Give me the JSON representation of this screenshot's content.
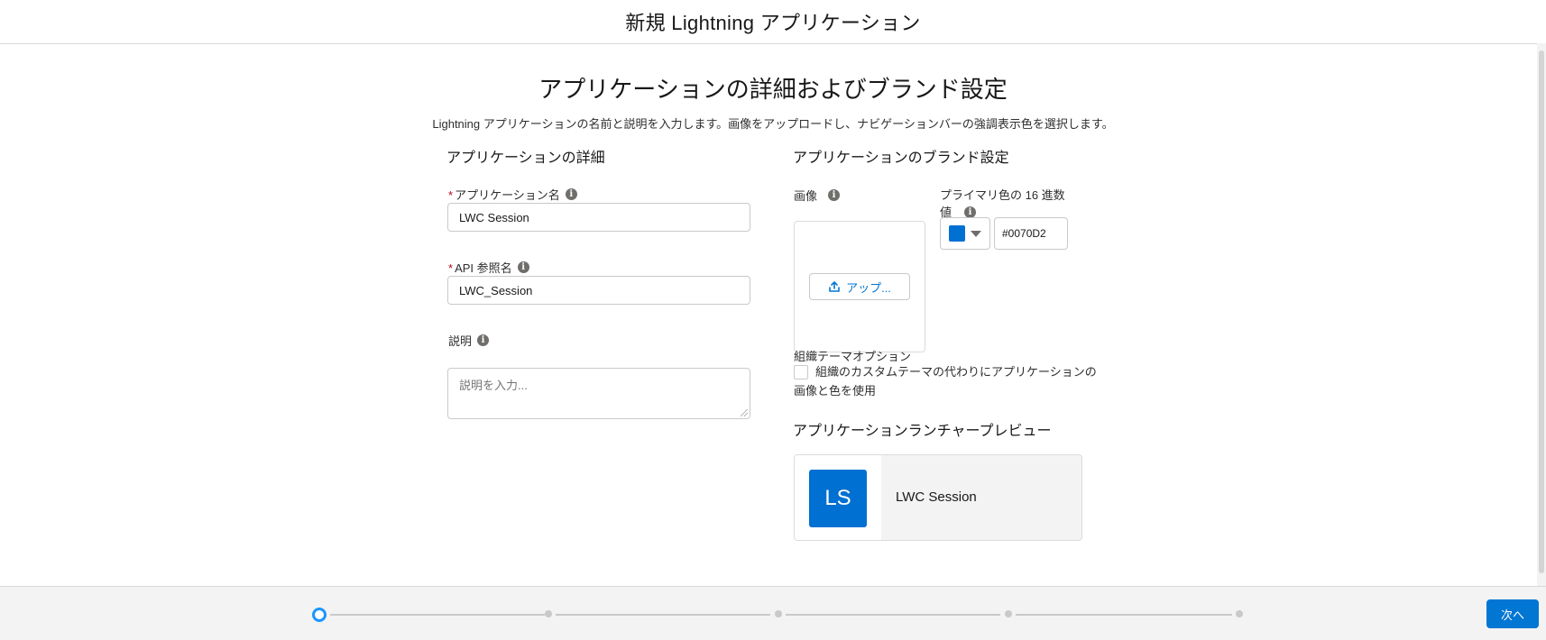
{
  "header": {
    "title": "新規 Lightning アプリケーション"
  },
  "page": {
    "title": "アプリケーションの詳細およびブランド設定",
    "subtitle": "Lightning アプリケーションの名前と説明を入力します。画像をアップロードし、ナビゲーションバーの強調表示色を選択します。"
  },
  "details": {
    "heading": "アプリケーションの詳細",
    "app_name": {
      "required_mark": "*",
      "label": "アプリケーション名",
      "value": "LWC Session"
    },
    "api_name": {
      "required_mark": "*",
      "label": "API 参照名",
      "value": "LWC_Session"
    },
    "description": {
      "label": "説明",
      "placeholder": "説明を入力..."
    }
  },
  "branding": {
    "heading": "アプリケーションのブランド設定",
    "image_label": "画像",
    "upload_label": "アップ...",
    "primary_color_label_line1": "プライマリ色の 16 進数",
    "primary_color_label_line2": "値",
    "primary_color_value": "#0070D2",
    "swatch_color": "#0070d2",
    "org_theme_label": "組織テーマオプション",
    "org_theme_checkbox_line1": "組織のカスタムテーマの代わりにアプリケーションの",
    "org_theme_checkbox_line2": "画像と色を使用",
    "org_theme_checked": false
  },
  "preview": {
    "heading": "アプリケーションランチャープレビュー",
    "initials": "LS",
    "app_name": "LWC Session"
  },
  "footer": {
    "current_step": 1,
    "total_steps": 5,
    "next_label": "次へ"
  },
  "icons": {
    "info": "info-icon",
    "upload": "upload-icon",
    "caret": "chevron-down-icon"
  },
  "colors": {
    "brand": "#0176d3",
    "progress_active": "#1b96ff",
    "required": "#ba0517"
  }
}
